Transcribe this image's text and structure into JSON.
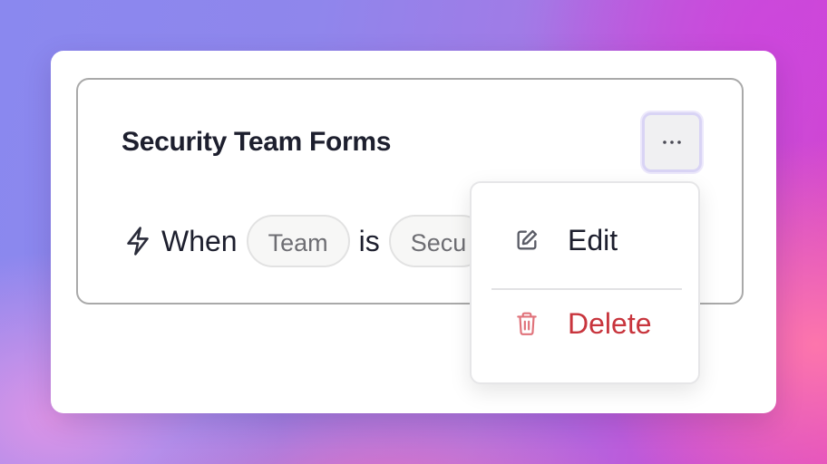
{
  "card": {
    "title": "Security Team Forms",
    "condition": {
      "prefix": "When",
      "field": "Team",
      "operator": "is",
      "value": "Secu"
    }
  },
  "more_button": {
    "icon": "more-horizontal-icon",
    "label": "···"
  },
  "menu": {
    "items": [
      {
        "label": "Edit",
        "icon": "edit-icon",
        "color": "#1d1f2e"
      },
      {
        "label": "Delete",
        "icon": "trash-icon",
        "color": "#c8353d"
      }
    ]
  },
  "colors": {
    "text": "#1d1f2e",
    "danger": "#c8353d",
    "chip_text": "#6e6e73",
    "focus_ring": "#d9d4f5"
  }
}
